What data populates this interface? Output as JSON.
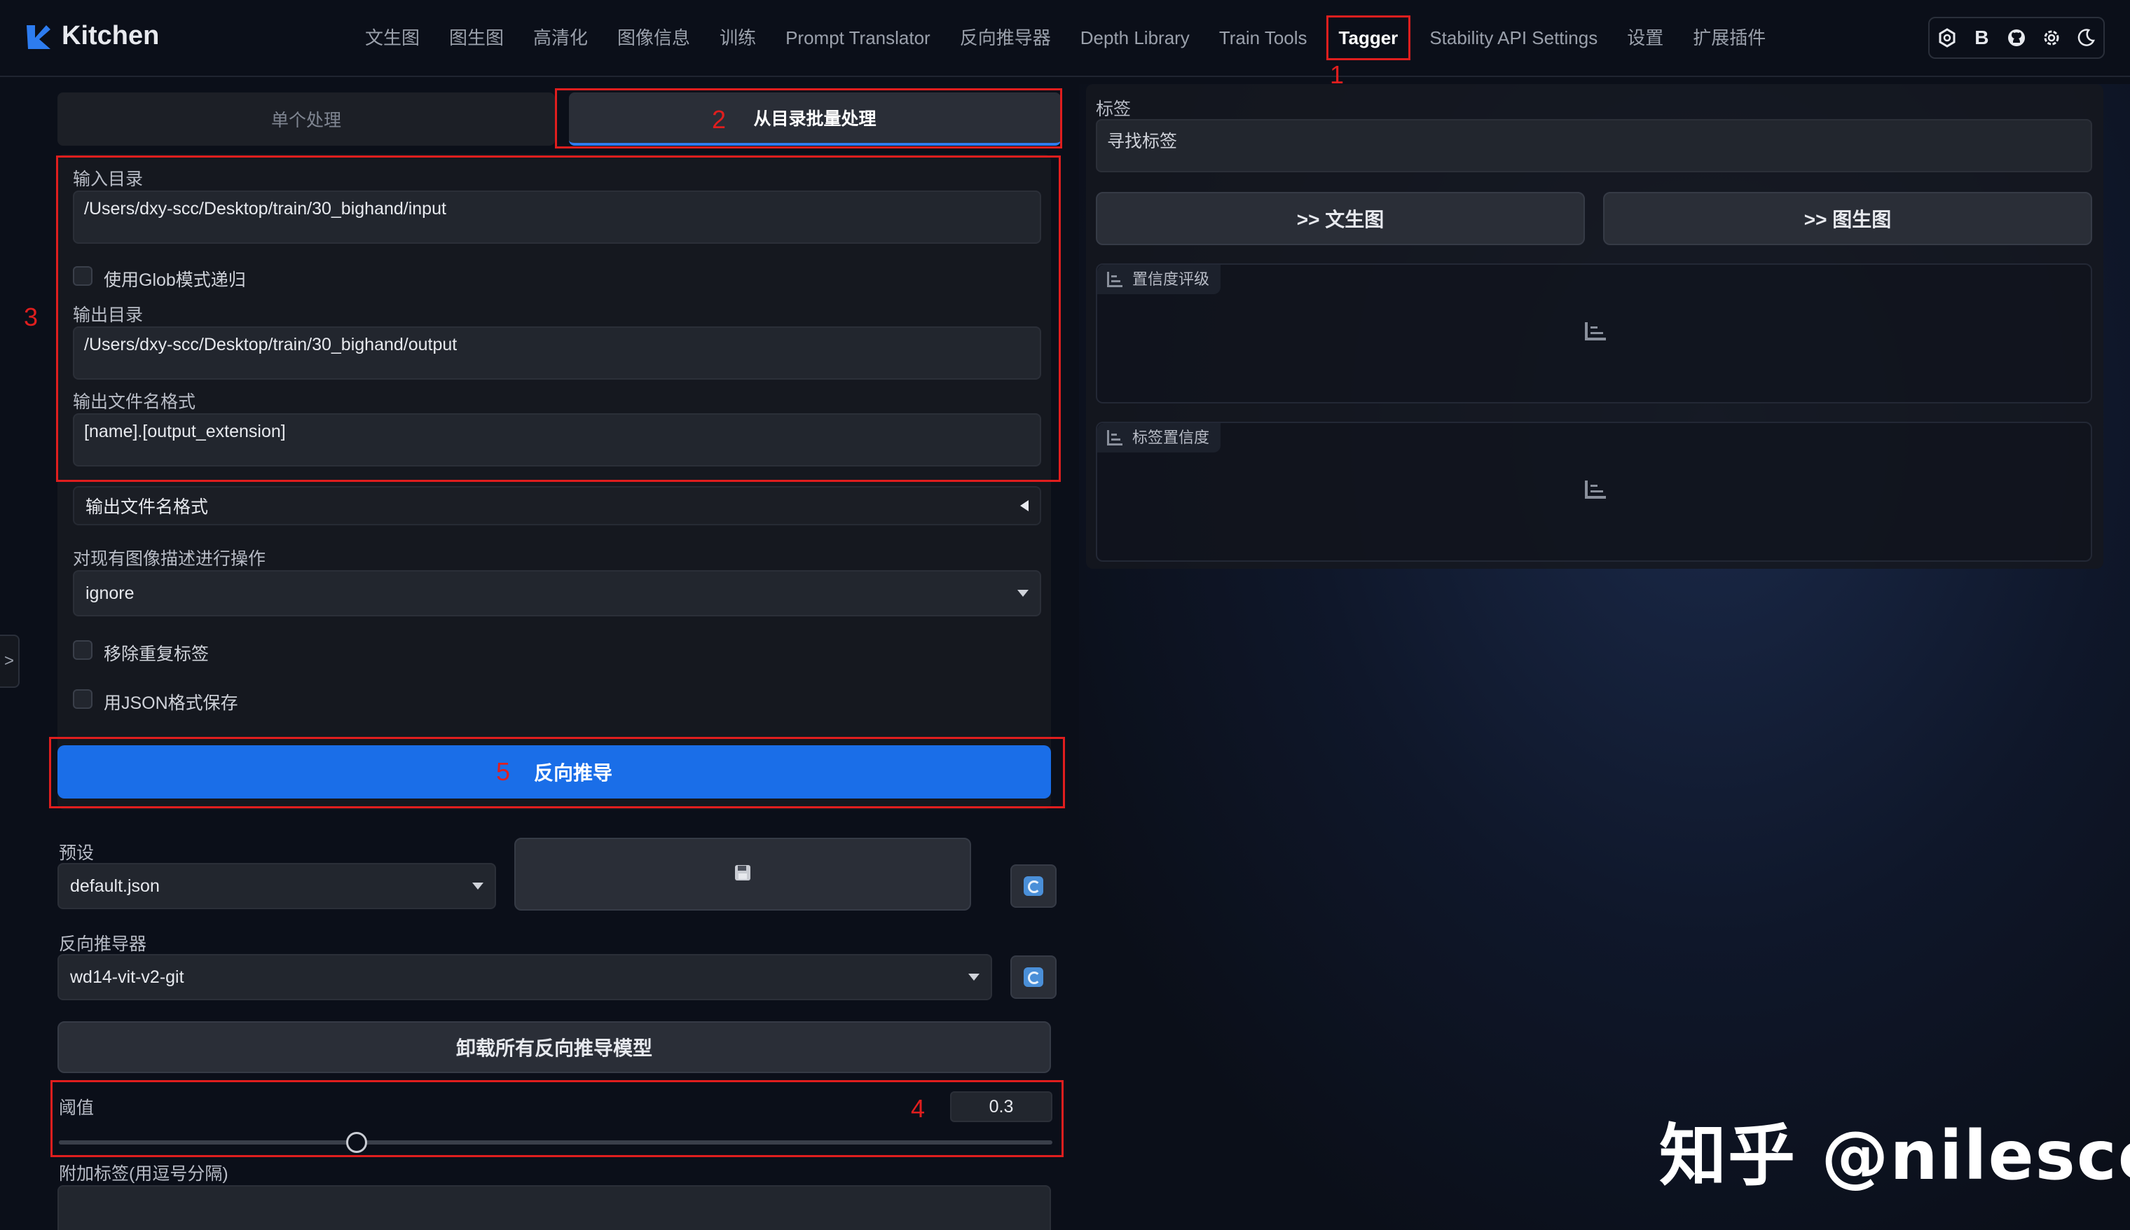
{
  "app": {
    "title": "Kitchen",
    "brand_color": "#2d7cf0"
  },
  "nav": {
    "items": [
      {
        "label": "文生图"
      },
      {
        "label": "图生图"
      },
      {
        "label": "高清化"
      },
      {
        "label": "图像信息"
      },
      {
        "label": "训练"
      },
      {
        "label": "Prompt Translator"
      },
      {
        "label": "反向推导器"
      },
      {
        "label": "Depth Library"
      },
      {
        "label": "Train Tools"
      },
      {
        "label": "Tagger"
      },
      {
        "label": "Stability API Settings"
      },
      {
        "label": "设置"
      },
      {
        "label": "扩展插件"
      }
    ],
    "active": "Tagger"
  },
  "toolbar_icons": [
    "openai-icon",
    "bold-b-icon",
    "github-icon",
    "settings-gear-icon",
    "dark-mode-moon-icon"
  ],
  "toolbar_b": "B",
  "annotations": {
    "a1": "1",
    "a2": "2",
    "a3": "3",
    "a4": "4",
    "a5": "5"
  },
  "tabs": {
    "single": "单个处理",
    "batch": "从目录批量处理"
  },
  "form": {
    "input_dir_label": "输入目录",
    "input_dir_value": "/Users/dxy-scc/Desktop/train/30_bighand/input",
    "glob_label": "使用Glob模式递归",
    "output_dir_label": "输出目录",
    "output_dir_value": "/Users/dxy-scc/Desktop/train/30_bighand/output",
    "filename_format_label": "输出文件名格式",
    "filename_format_value": "[name].[output_extension]",
    "accordion_label": "输出文件名格式",
    "existing_action_label": "对现有图像描述进行操作",
    "existing_action_value": "ignore",
    "remove_dup_label": "移除重复标签",
    "json_save_label": "用JSON格式保存"
  },
  "interrogate_button": "反向推导",
  "preset": {
    "label": "预设",
    "value": "default.json"
  },
  "interrogator": {
    "label": "反向推导器",
    "value": "wd14-vit-v2-git"
  },
  "unload_button": "卸载所有反向推导模型",
  "threshold": {
    "label": "阈值",
    "value": "0.3",
    "fraction": 0.3
  },
  "additional_tags_label": "附加标签(用逗号分隔)",
  "right": {
    "tags_label": "标签",
    "tags_placeholder": "寻找标签",
    "to_txt2img": ">> 文生图",
    "to_img2img": ">> 图生图",
    "rating_label": "置信度评级",
    "tag_confidence_label": "标签置信度"
  },
  "left_edge_arrow": ">",
  "watermark": "知乎 @nilescc"
}
